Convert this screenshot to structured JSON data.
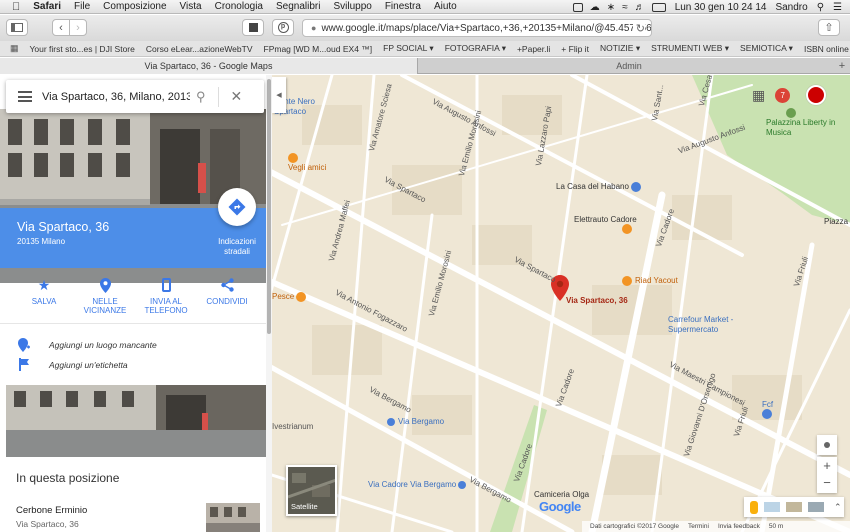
{
  "menubar": {
    "app": "Safari",
    "items": [
      "File",
      "Composizione",
      "Vista",
      "Cronologia",
      "Segnalibri",
      "Sviluppo",
      "Finestra",
      "Aiuto"
    ],
    "clock": "Lun 30 gen  10 24 14",
    "user": "Sandro"
  },
  "toolbar": {
    "url": "www.google.it/maps/place/Via+Spartaco,+36,+20135+Milano/@45.4577566,9.2"
  },
  "bookmarks": [
    "Your first sto...es | DJI Store",
    "Corso eLear...azioneWebTV",
    "FPmag [WD M...oud EX4 ™]",
    "FP SOCIAL ▾",
    "FOTOGRAFIA ▾",
    "+Paper.li",
    "+ Flip it",
    "NOTIZIE ▾",
    "STRUMENTI WEB ▾",
    "SEMIOTICA ▾",
    "ISBN online"
  ],
  "tabs": {
    "active": "Via Spartaco, 36 - Google Maps",
    "inactive": "Admin"
  },
  "panel": {
    "search_value": "Via Spartaco, 36, Milano, 20135 M",
    "place_title": "Via Spartaco, 36",
    "place_subtitle": "20135 Milano",
    "directions_label": "Indicazioni stradali",
    "actions": {
      "save": "SALVA",
      "nearby": "NELLE VICINANZE",
      "send": "INVIA AL TELEFONO",
      "share": "CONDIVIDI"
    },
    "add_place": "Aggiungi un luogo mancante",
    "add_label": "Aggiungi un'etichetta",
    "section_title": "In questa posizione",
    "nearby_name": "Cerbone Erminio",
    "nearby_address": "Via Spartaco, 36"
  },
  "map": {
    "marker_label": "Via Spartaco, 36",
    "notification_count": "7",
    "streets": {
      "spartaco_top": "Via Spartaco",
      "spartaco_mid": "Via Spartaco",
      "fogazzaro": "Via Antonio Fogazzaro",
      "morosini_top": "Via Emilio Morosini",
      "morosini_mid": "Via Emilio Morosini",
      "cadore_a": "Via Cadore",
      "cadore_b": "Via Cadore",
      "cadore_c": "Via Cadore",
      "lazzaro": "Via Lazzaro Papi",
      "amatore": "Via Amatore Sciesa",
      "mattei": "Via Andrea Maffei",
      "augusto_a": "Via Augusto Anfossi",
      "augusto_b": "Via Augusto Anfossi",
      "bergamo_a": "Via Bergamo",
      "bergamo_b": "Via Bergamo",
      "campionesi": "Via Maestri Campionesi",
      "friuli_a": "Via Friuli",
      "friuli_b": "Via Friuli",
      "orsenigo": "Via Giovanni D'Orsenigo",
      "vestrinum": "Ivestrianum",
      "angelo": "Via Sant...",
      "cesare": "Via Cesare..."
    },
    "pois": {
      "cante": "Cante Nero",
      "spartaco_poi": "Spartaco",
      "vegli": "Vegli amici",
      "habano": "La Casa del Habano",
      "elettrauto": "Elettrauto Cadore",
      "riad": "Riad Yacout",
      "carrefour": "Carrefour Market - Supermercato",
      "pesce": "Pesce",
      "palazzina": "Palazzina Liberty in Musica",
      "piazza": "Piazza Le...",
      "fcf": "Fcf",
      "via_bergamo_bus": "Via Bergamo",
      "cadore_bergamo": "Via Cadore Via Bergamo",
      "camiceria": "Camiceria Olga"
    },
    "satellite_label": "Satellite",
    "google": "Google",
    "footer": [
      "Dati cartografici ©2017 Google",
      "Termini",
      "Invia feedback",
      "50 m"
    ]
  }
}
